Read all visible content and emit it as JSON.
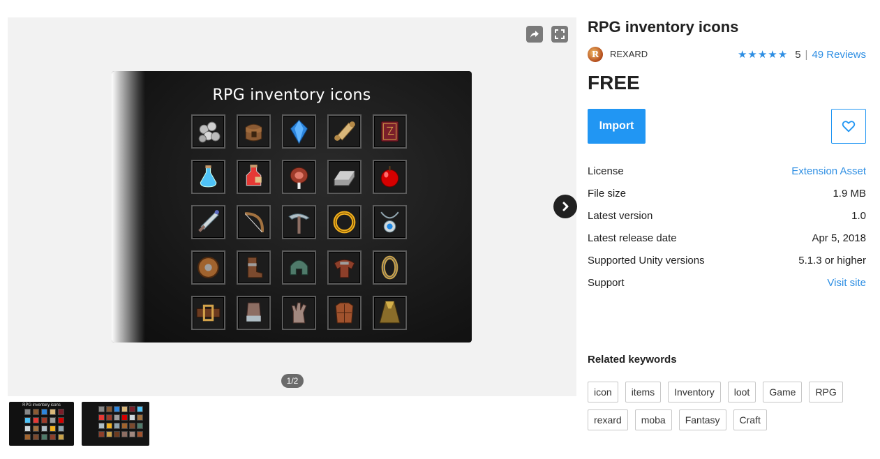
{
  "gallery": {
    "share_icon": "share-icon",
    "fullscreen_icon": "fullscreen-icon",
    "next_icon": "chevron-right-icon",
    "slide_title": "RPG inventory icons",
    "counter": "1/2",
    "thumbnail_title": "RPG inventory icons",
    "icons": [
      "coins-icon",
      "pouch-icon",
      "gem-icon",
      "scroll-icon",
      "spellbook-icon",
      "mana-potion-icon",
      "health-potion-icon",
      "meat-icon",
      "ingot-icon",
      "apple-icon",
      "sword-icon",
      "bow-icon",
      "pickaxe-icon",
      "ring-icon",
      "amulet-icon",
      "shield-icon",
      "boots-icon",
      "helmet-icon",
      "pauldrons-icon",
      "bracelet-icon",
      "belt-icon",
      "gauntlet-icon",
      "glove-icon",
      "chest-armor-icon",
      "cloak-icon"
    ]
  },
  "product": {
    "title": "RPG inventory icons",
    "publisher": "REXARD",
    "publisher_logo_letter": "R",
    "stars": "★★★★★",
    "rating": "5",
    "rating_separator": "|",
    "reviews": "49 Reviews",
    "price": "FREE",
    "import_label": "Import",
    "favorite_icon": "heart-icon"
  },
  "details": [
    {
      "label": "License",
      "value": "Extension Asset",
      "link": true
    },
    {
      "label": "File size",
      "value": "1.9 MB",
      "link": false
    },
    {
      "label": "Latest version",
      "value": "1.0",
      "link": false
    },
    {
      "label": "Latest release date",
      "value": "Apr 5, 2018",
      "link": false
    },
    {
      "label": "Supported Unity versions",
      "value": "5.1.3 or higher",
      "link": false
    },
    {
      "label": "Support",
      "value": "Visit site",
      "link": true
    }
  ],
  "keywords_title": "Related keywords",
  "keywords": [
    "icon",
    "items",
    "Inventory",
    "loot",
    "Game",
    "RPG",
    "rexard",
    "moba",
    "Fantasy",
    "Craft"
  ],
  "colors": {
    "accent": "#2196f3",
    "link": "#2d8ee3",
    "gallery_bg": "#f2f2f2"
  }
}
